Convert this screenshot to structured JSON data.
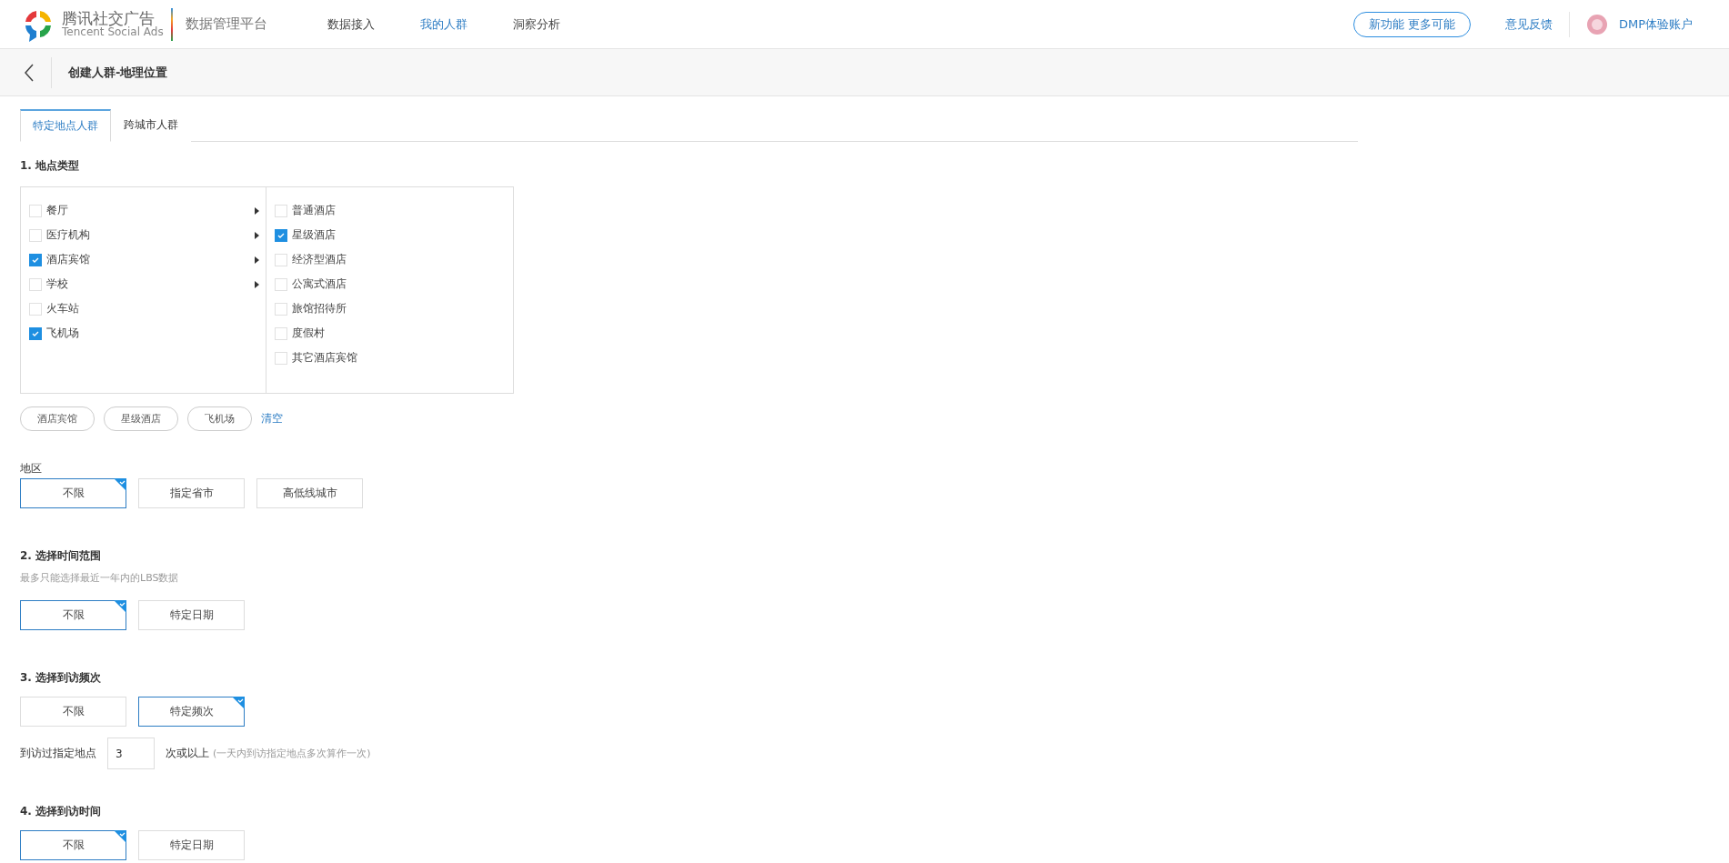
{
  "header": {
    "logo_name": "腾讯社交广告",
    "logo_subtitle": "Tencent Social Ads",
    "platform": "数据管理平台",
    "nav": [
      {
        "label": "数据接入",
        "selected": false
      },
      {
        "label": "我的人群",
        "selected": true
      },
      {
        "label": "洞察分析",
        "selected": false
      }
    ],
    "new_feature_button": "新功能 更多可能",
    "feedback": "意见反馈",
    "account": "DMP体验账户"
  },
  "page_title": "创建人群-地理位置",
  "tabs": [
    {
      "label": "特定地点人群",
      "selected": true
    },
    {
      "label": "跨城市人群",
      "selected": false
    }
  ],
  "location_type": {
    "title": "1. 地点类型",
    "categories": [
      {
        "label": "餐厅",
        "checked": false,
        "expandable": true
      },
      {
        "label": "医疗机构",
        "checked": false,
        "expandable": true
      },
      {
        "label": "酒店宾馆",
        "checked": true,
        "expandable": true
      },
      {
        "label": "学校",
        "checked": false,
        "expandable": true
      },
      {
        "label": "火车站",
        "checked": false,
        "expandable": false
      },
      {
        "label": "飞机场",
        "checked": true,
        "expandable": false
      }
    ],
    "subcategories": [
      {
        "label": "普通酒店",
        "checked": false
      },
      {
        "label": "星级酒店",
        "checked": true
      },
      {
        "label": "经济型酒店",
        "checked": false
      },
      {
        "label": "公寓式酒店",
        "checked": false
      },
      {
        "label": "旅馆招待所",
        "checked": false
      },
      {
        "label": "度假村",
        "checked": false
      },
      {
        "label": "其它酒店宾馆",
        "checked": false
      }
    ],
    "tags": [
      "酒店宾馆",
      "星级酒店",
      "飞机场"
    ],
    "clear": "清空"
  },
  "region": {
    "label": "地区",
    "options": [
      {
        "label": "不限",
        "selected": true
      },
      {
        "label": "指定省市",
        "selected": false
      },
      {
        "label": "高低线城市",
        "selected": false
      }
    ]
  },
  "time_range": {
    "title": "2. 选择时间范围",
    "note": "最多只能选择最近一年内的LBS数据",
    "options": [
      {
        "label": "不限",
        "selected": true
      },
      {
        "label": "特定日期",
        "selected": false
      }
    ]
  },
  "frequency": {
    "title": "3. 选择到访频次",
    "options": [
      {
        "label": "不限",
        "selected": false
      },
      {
        "label": "特定频次",
        "selected": true
      }
    ],
    "input_label": "到访过指定地点",
    "value": "3",
    "suffix": "次或以上",
    "hint": "(一天内到访指定地点多次算作一次)"
  },
  "visit_time": {
    "title": "4. 选择到访时间",
    "options": [
      {
        "label": "不限",
        "selected": true
      },
      {
        "label": "特定日期",
        "selected": false
      }
    ]
  }
}
